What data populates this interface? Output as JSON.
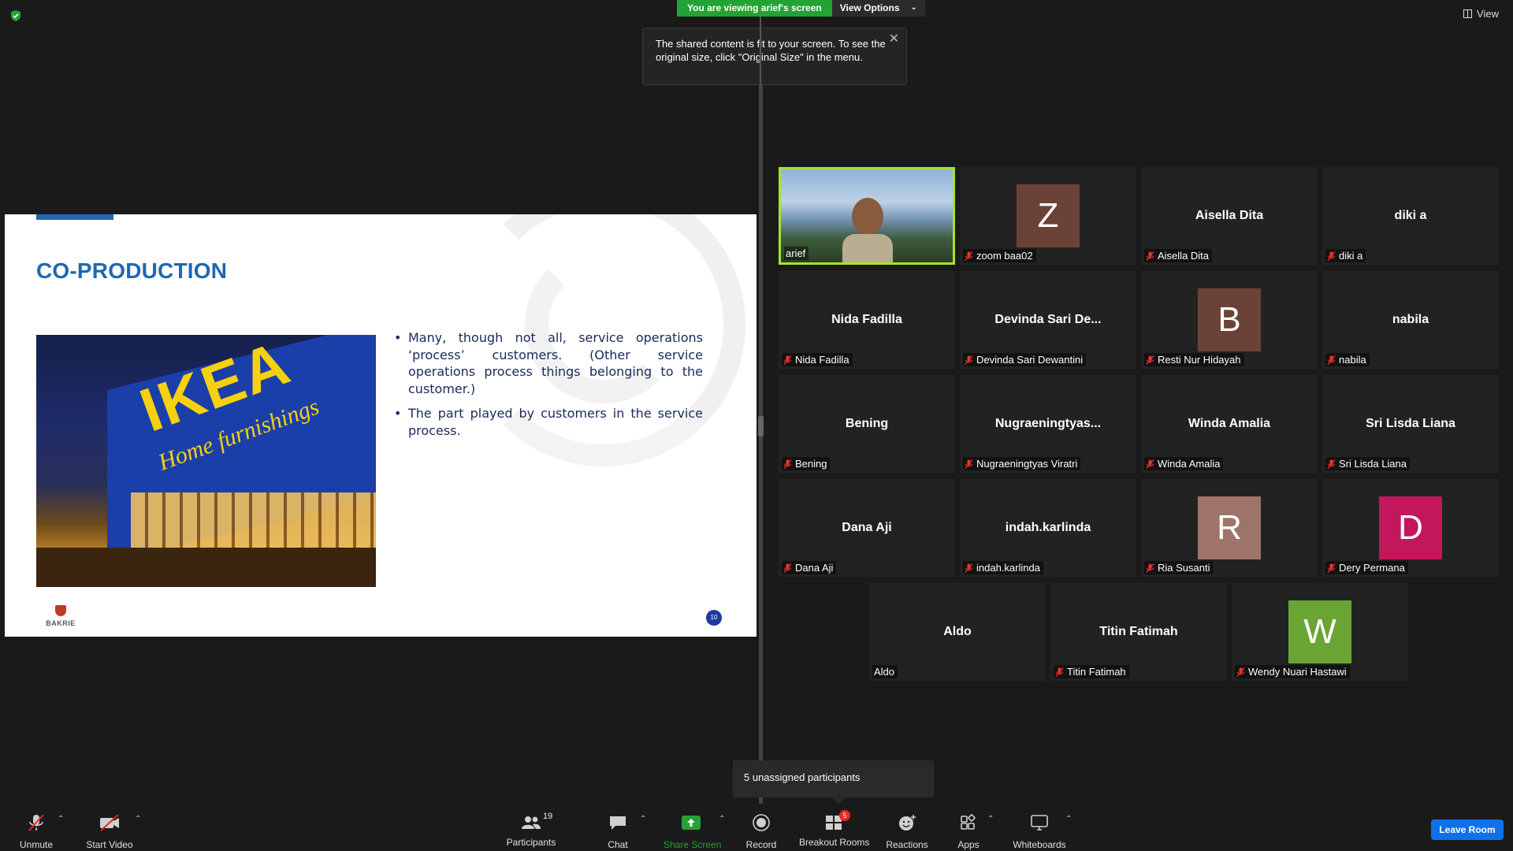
{
  "banner": {
    "viewing": "You are viewing arief's screen",
    "view_options": "View Options"
  },
  "top_right": {
    "view_label": "View"
  },
  "tooltip": {
    "text": "The shared content is fit to your screen. To see the original size, click \"Original Size\" in the menu."
  },
  "slide": {
    "title": "CO-PRODUCTION",
    "photo_text_main": "IKEA",
    "photo_text_sub": "Home furnishings",
    "bullets": [
      "Many, though not all, service operations ‘process’ customers. (Other service operations process things belonging to the customer.)",
      "The part played by customers in the service process."
    ],
    "logo_text": "BAKRIE",
    "page_number": "10"
  },
  "gallery": [
    {
      "display": "",
      "name": "arief",
      "type": "video",
      "muted": false,
      "active": true
    },
    {
      "display": "Z",
      "name": "zoom baa02",
      "type": "avatar",
      "avatar_color": "#6b4336",
      "muted": true
    },
    {
      "display": "Aisella Dita",
      "name": "Aisella Dita",
      "type": "name",
      "muted": true
    },
    {
      "display": "diki a",
      "name": "diki a",
      "type": "name",
      "muted": true
    },
    {
      "display": "Nida Fadilla",
      "name": "Nida Fadilla",
      "type": "name",
      "muted": true
    },
    {
      "display": "Devinda Sari De...",
      "name": "Devinda Sari Dewantini",
      "type": "name",
      "muted": true
    },
    {
      "display": "B",
      "name": "Resti Nur Hidayah",
      "type": "avatar",
      "avatar_color": "#6b4336",
      "muted": true
    },
    {
      "display": "nabila",
      "name": "nabila",
      "type": "name",
      "muted": true
    },
    {
      "display": "Bening",
      "name": "Bening",
      "type": "name",
      "muted": true
    },
    {
      "display": "Nugraeningtyas...",
      "name": "Nugraeningtyas Viratri",
      "type": "name",
      "muted": true
    },
    {
      "display": "Winda Amalia",
      "name": "Winda Amalia",
      "type": "name",
      "muted": true
    },
    {
      "display": "Sri Lisda Liana",
      "name": "Sri Lisda Liana",
      "type": "name",
      "muted": true
    },
    {
      "display": "Dana Aji",
      "name": "Dana Aji",
      "type": "name",
      "muted": true
    },
    {
      "display": "indah.karlinda",
      "name": "indah.karlinda",
      "type": "name",
      "muted": true
    },
    {
      "display": "R",
      "name": "Ria Susanti",
      "type": "avatar",
      "avatar_color": "#9e7468",
      "muted": true
    },
    {
      "display": "D",
      "name": "Dery Permana",
      "type": "avatar",
      "avatar_color": "#c2185b",
      "muted": true
    },
    {
      "display": "Aldo",
      "name": "Aldo",
      "type": "name",
      "muted": false
    },
    {
      "display": "Titin Fatimah",
      "name": "Titin Fatimah",
      "type": "name",
      "muted": true
    },
    {
      "display": "W",
      "name": "Wendy Nuari Hastawi",
      "type": "avatar",
      "avatar_color": "#6aa534",
      "muted": true
    }
  ],
  "unassigned": "5 unassigned participants",
  "toolbar": {
    "unmute": "Unmute",
    "start_video": "Start Video",
    "participants": "Participants",
    "participants_count": "19",
    "chat": "Chat",
    "share_screen": "Share Screen",
    "record": "Record",
    "breakout_rooms": "Breakout Rooms",
    "breakout_count": "5",
    "reactions": "Reactions",
    "apps": "Apps",
    "whiteboards": "Whiteboards",
    "leave_room": "Leave Room"
  },
  "colors": {
    "accent_green": "#23a334",
    "active_border": "#a6e22e",
    "leave_blue": "#0e71eb",
    "share_green": "#23a334",
    "slide_blue": "#1f67b1"
  }
}
